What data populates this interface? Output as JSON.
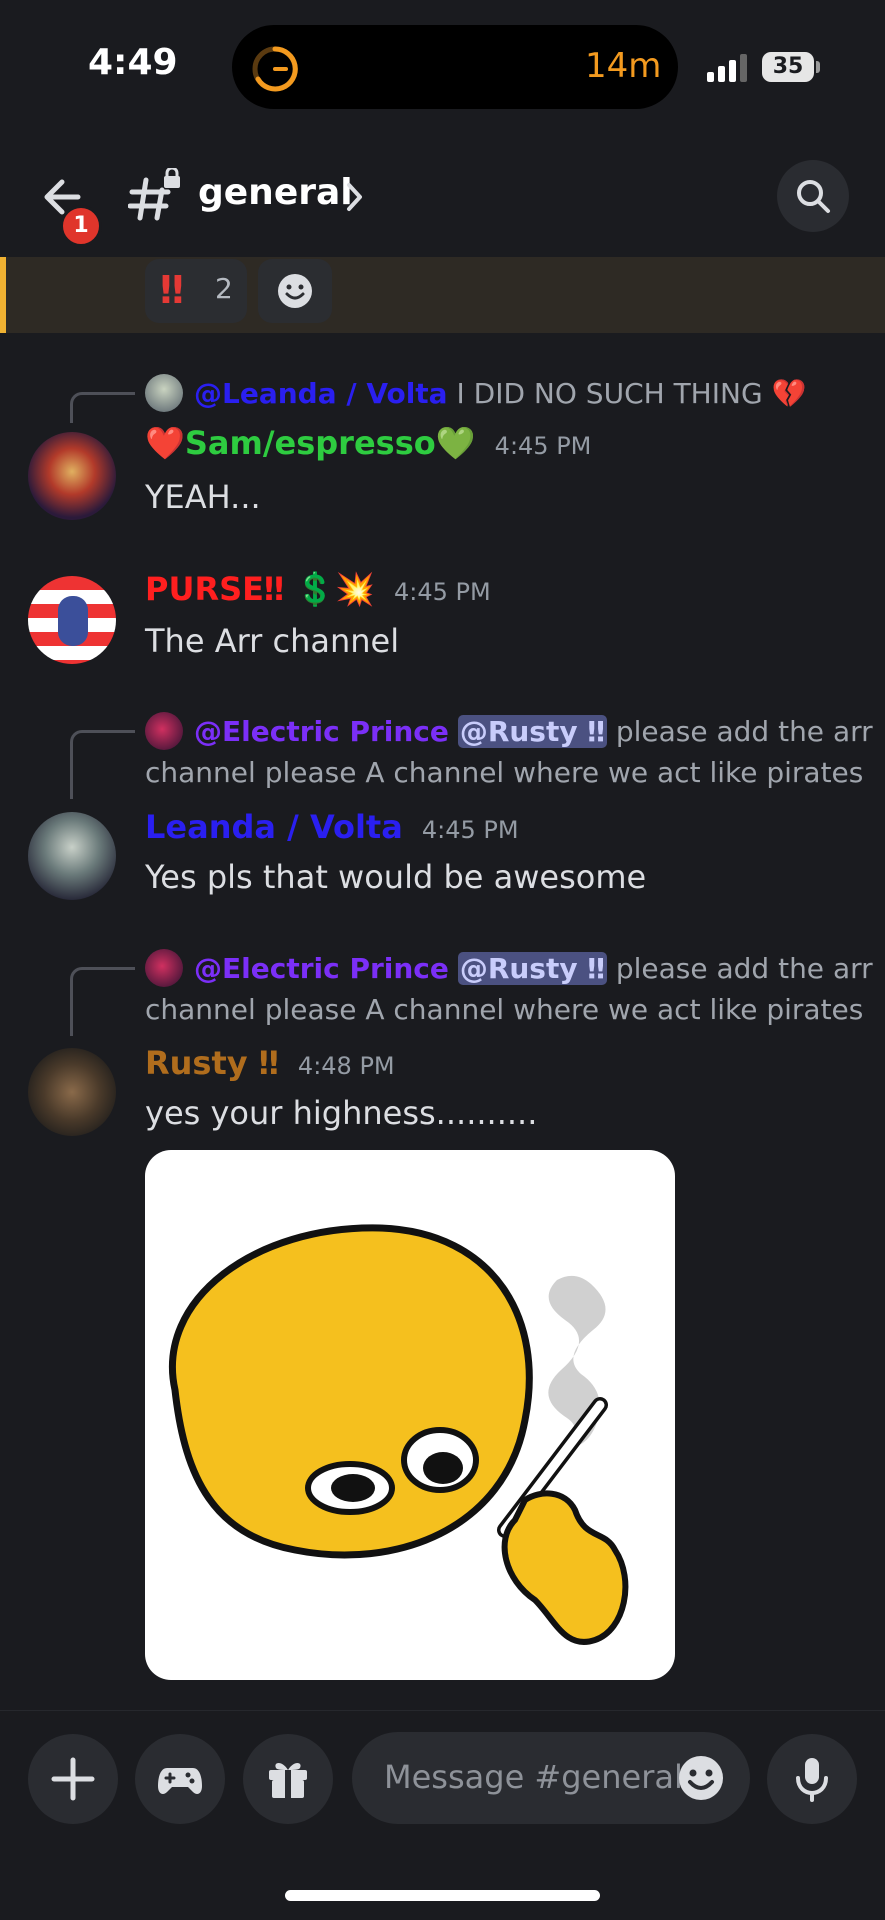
{
  "status_bar": {
    "time": "4:49",
    "timer": "14m",
    "battery": "35",
    "icons": [
      "timer-icon",
      "signal-icon",
      "battery-icon"
    ]
  },
  "header": {
    "notification_count": "1",
    "channel_name": "general",
    "icons": [
      "back-arrow-icon",
      "locked-channel-icon",
      "chevron-right-icon",
      "search-icon"
    ]
  },
  "reactions": [
    {
      "emoji": "‼",
      "count": "2"
    },
    {
      "emoji": "add-reaction-icon",
      "count": ""
    }
  ],
  "messages": [
    {
      "reply_to": {
        "mention": "@Leanda / Volta",
        "text": "I DID NO SUCH THING 💔"
      },
      "username_prefix": "❤️",
      "username": "Sam/espresso",
      "username_suffix": "💚",
      "username_color": "#2ecc40",
      "time": "4:45 PM",
      "text": "YEAH..."
    },
    {
      "username": "PURSE‼",
      "username_suffix": "💲💥",
      "username_color": "#ff1f1f",
      "time": "4:45 PM",
      "text": "The Arr channel"
    },
    {
      "reply_to": {
        "mention": "@Electric Prince",
        "mention2": "@Rusty ‼",
        "text": "please add the arr",
        "text2": "channel please A channel where we act like pirates"
      },
      "username": "Leanda / Volta",
      "username_color": "#2a1ff0",
      "time": "4:45 PM",
      "text": "Yes pls that would be awesome"
    },
    {
      "reply_to": {
        "mention": "@Electric Prince",
        "mention2": "@Rusty ‼",
        "text": "please add the arr",
        "text2": "channel please A channel where we act like pirates"
      },
      "username": "Rusty ‼",
      "username_color": "#b06d1d",
      "time": "4:48 PM",
      "text": "yes your highness..........",
      "attachment": "smoking-emoji-image"
    }
  ],
  "composer": {
    "placeholder": "Message #general",
    "buttons": [
      "plus-icon",
      "gamepad-icon",
      "gift-icon",
      "emoji-icon",
      "microphone-icon"
    ]
  },
  "colors": {
    "background": "#1a1b1f",
    "mention_reply": "#7b2ff7",
    "leanda_mention": "#2a1ff0",
    "timer_orange": "#f39a1f",
    "notification_red": "#e0352b"
  }
}
